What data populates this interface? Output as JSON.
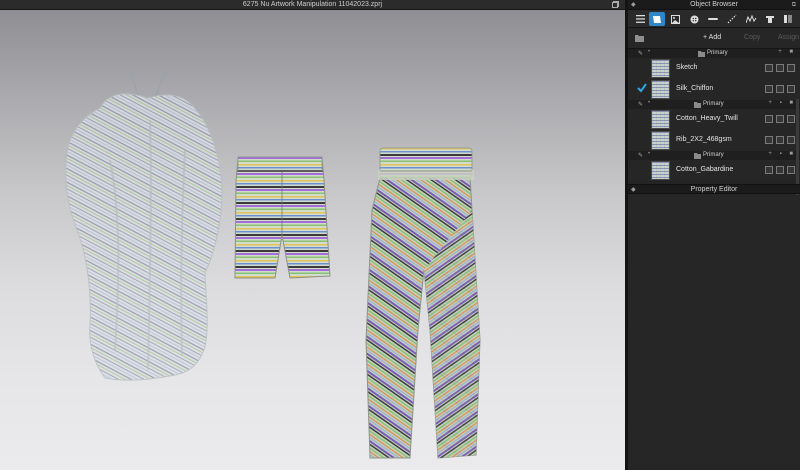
{
  "window": {
    "title": "6275 Nu Artwork Manipulation 11042023.zprj"
  },
  "object_browser": {
    "title": "Object Browser",
    "tabs": [
      {
        "icon": "list-icon"
      },
      {
        "icon": "fabric-icon",
        "active": true
      },
      {
        "icon": "graphic-icon"
      },
      {
        "icon": "button-icon"
      },
      {
        "icon": "buttonhole-icon"
      },
      {
        "icon": "topstitch-icon"
      },
      {
        "icon": "puckering-icon"
      },
      {
        "icon": "trim-icon"
      },
      {
        "icon": "avatar-icon"
      }
    ],
    "actions": {
      "add": "+ Add",
      "copy": "Copy",
      "assign": "Assign"
    },
    "groups": [
      {
        "label": "Primary"
      },
      {
        "label": "Primary"
      },
      {
        "label": "Primary"
      }
    ],
    "fabrics": [
      {
        "name": "Sketch",
        "selected": false
      },
      {
        "name": "Silk_Chiffon",
        "selected": true
      },
      {
        "name": "Cotton_Heavy_Twill",
        "selected": false
      },
      {
        "name": "Rib_2X2_468gsm",
        "selected": false
      },
      {
        "name": "Cotton_Gabardine",
        "selected": false
      }
    ],
    "accent_color": "#2f86c9"
  },
  "property_editor": {
    "title": "Property Editor"
  }
}
